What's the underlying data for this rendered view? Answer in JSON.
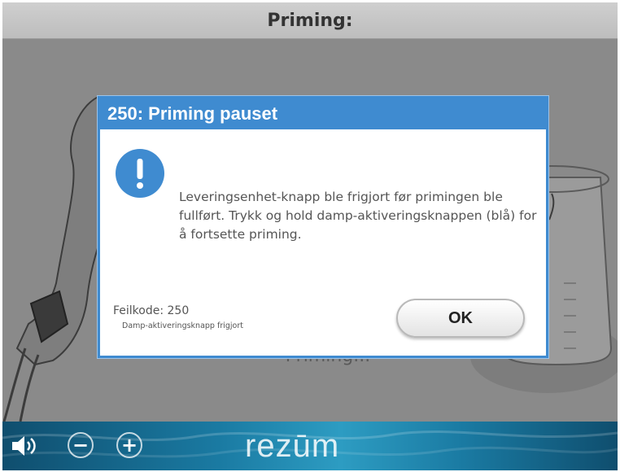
{
  "screen": {
    "title": "Priming:"
  },
  "background": {
    "status_text": "Priming..."
  },
  "dialog": {
    "title": "250: Priming pauset",
    "message": "Leveringsenhet-knapp ble frigjort før primingen ble fullført. Trykk og hold damp-aktiveringsknappen (blå) for å fortsette priming.",
    "error_code": "Feilkode: 250",
    "error_description": "Damp-aktiveringsknapp frigjort",
    "ok_label": "OK",
    "icon": "info-exclamation-icon"
  },
  "footer": {
    "brand": "rezūm",
    "volume_icon": "speaker-icon",
    "decrease_label": "−",
    "increase_label": "+"
  },
  "colors": {
    "dialog_accent": "#3f8bd0",
    "backdrop": "#8a8a8a",
    "footer": "#1a7aa2"
  }
}
